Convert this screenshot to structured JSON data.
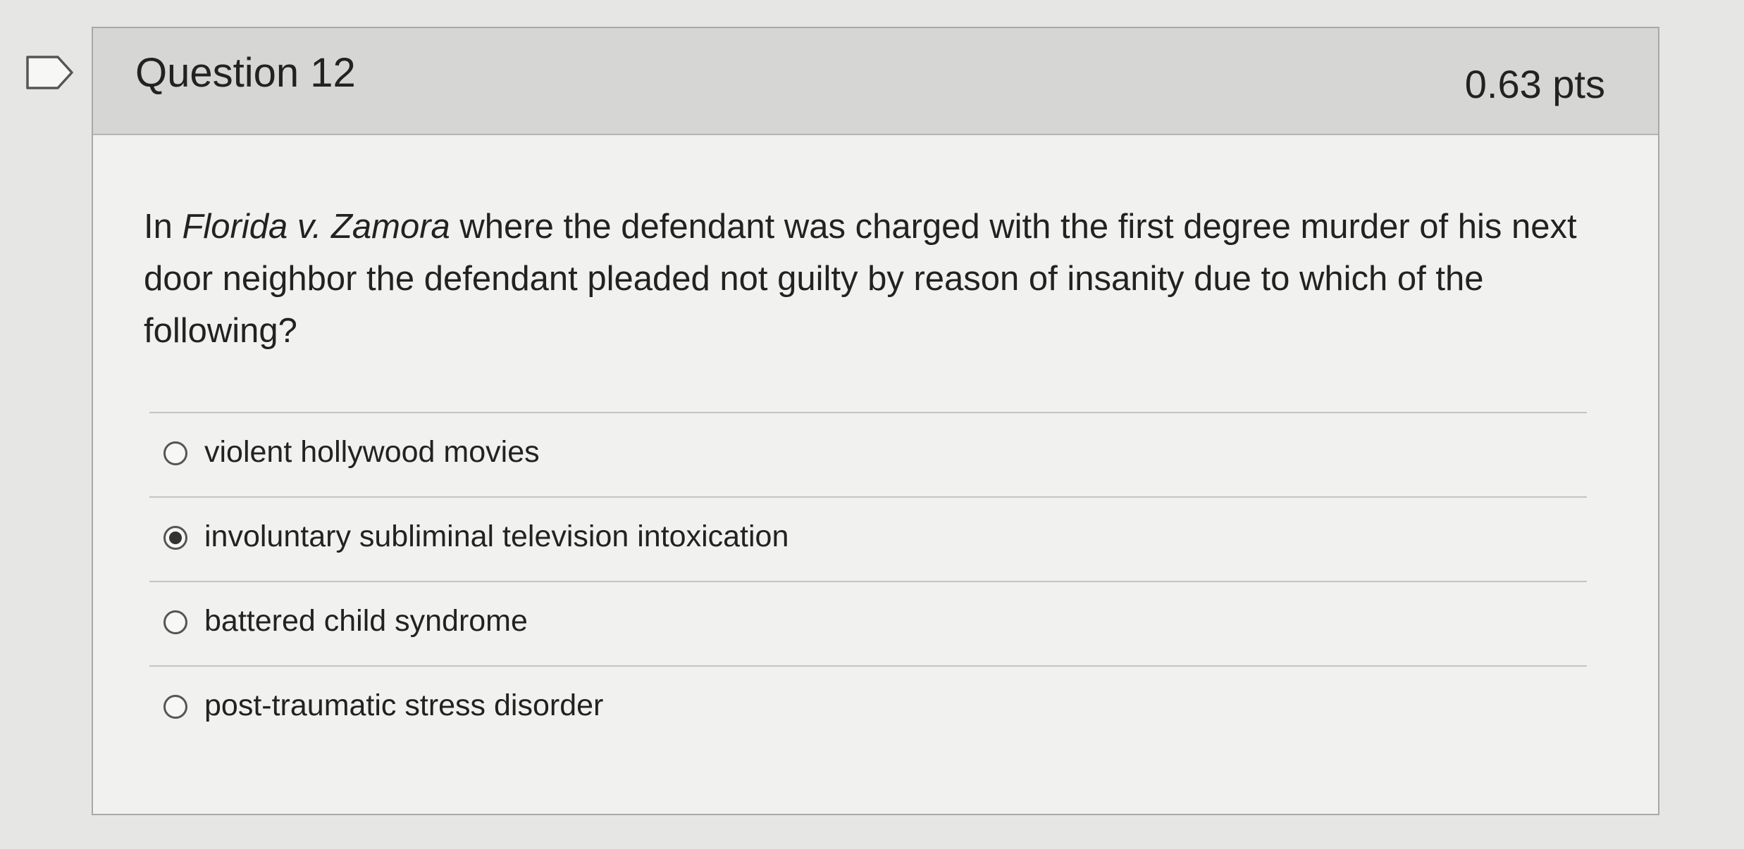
{
  "question": {
    "title": "Question 12",
    "points": "0.63 pts",
    "text_case_name": "Florida v. Zamora",
    "text_prefix": "In ",
    "text_suffix": " where the defendant was charged with the first degree murder of his next door neighbor the defendant pleaded not guilty by reason of insanity due to which of the following?"
  },
  "answers": [
    {
      "label": "violent hollywood movies",
      "selected": false
    },
    {
      "label": "involuntary subliminal television intoxication",
      "selected": true
    },
    {
      "label": "battered child syndrome",
      "selected": false
    },
    {
      "label": "post-traumatic stress disorder",
      "selected": false
    }
  ]
}
